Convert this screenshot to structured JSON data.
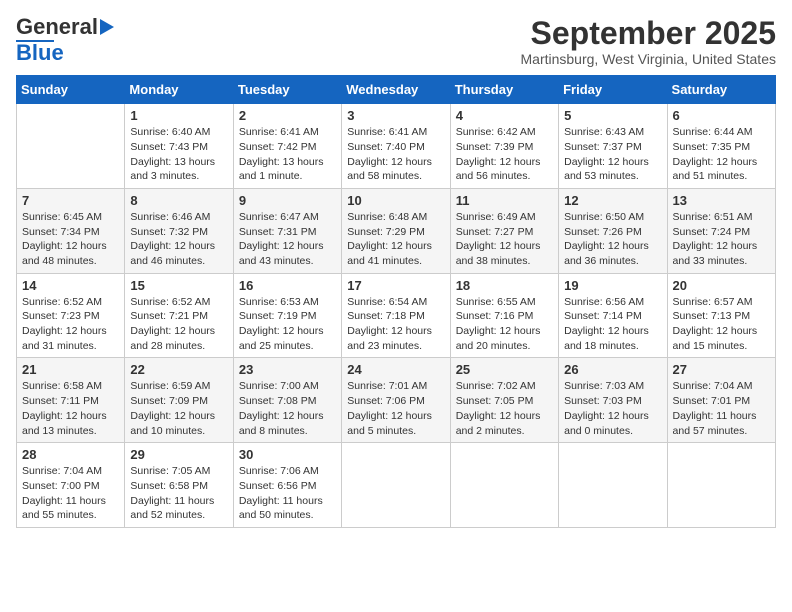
{
  "header": {
    "logo_line1": "General",
    "logo_line2": "Blue",
    "month_title": "September 2025",
    "location": "Martinsburg, West Virginia, United States"
  },
  "columns": [
    "Sunday",
    "Monday",
    "Tuesday",
    "Wednesday",
    "Thursday",
    "Friday",
    "Saturday"
  ],
  "weeks": [
    [
      {
        "day": "",
        "info": ""
      },
      {
        "day": "1",
        "info": "Sunrise: 6:40 AM\nSunset: 7:43 PM\nDaylight: 13 hours\nand 3 minutes."
      },
      {
        "day": "2",
        "info": "Sunrise: 6:41 AM\nSunset: 7:42 PM\nDaylight: 13 hours\nand 1 minute."
      },
      {
        "day": "3",
        "info": "Sunrise: 6:41 AM\nSunset: 7:40 PM\nDaylight: 12 hours\nand 58 minutes."
      },
      {
        "day": "4",
        "info": "Sunrise: 6:42 AM\nSunset: 7:39 PM\nDaylight: 12 hours\nand 56 minutes."
      },
      {
        "day": "5",
        "info": "Sunrise: 6:43 AM\nSunset: 7:37 PM\nDaylight: 12 hours\nand 53 minutes."
      },
      {
        "day": "6",
        "info": "Sunrise: 6:44 AM\nSunset: 7:35 PM\nDaylight: 12 hours\nand 51 minutes."
      }
    ],
    [
      {
        "day": "7",
        "info": "Sunrise: 6:45 AM\nSunset: 7:34 PM\nDaylight: 12 hours\nand 48 minutes."
      },
      {
        "day": "8",
        "info": "Sunrise: 6:46 AM\nSunset: 7:32 PM\nDaylight: 12 hours\nand 46 minutes."
      },
      {
        "day": "9",
        "info": "Sunrise: 6:47 AM\nSunset: 7:31 PM\nDaylight: 12 hours\nand 43 minutes."
      },
      {
        "day": "10",
        "info": "Sunrise: 6:48 AM\nSunset: 7:29 PM\nDaylight: 12 hours\nand 41 minutes."
      },
      {
        "day": "11",
        "info": "Sunrise: 6:49 AM\nSunset: 7:27 PM\nDaylight: 12 hours\nand 38 minutes."
      },
      {
        "day": "12",
        "info": "Sunrise: 6:50 AM\nSunset: 7:26 PM\nDaylight: 12 hours\nand 36 minutes."
      },
      {
        "day": "13",
        "info": "Sunrise: 6:51 AM\nSunset: 7:24 PM\nDaylight: 12 hours\nand 33 minutes."
      }
    ],
    [
      {
        "day": "14",
        "info": "Sunrise: 6:52 AM\nSunset: 7:23 PM\nDaylight: 12 hours\nand 31 minutes."
      },
      {
        "day": "15",
        "info": "Sunrise: 6:52 AM\nSunset: 7:21 PM\nDaylight: 12 hours\nand 28 minutes."
      },
      {
        "day": "16",
        "info": "Sunrise: 6:53 AM\nSunset: 7:19 PM\nDaylight: 12 hours\nand 25 minutes."
      },
      {
        "day": "17",
        "info": "Sunrise: 6:54 AM\nSunset: 7:18 PM\nDaylight: 12 hours\nand 23 minutes."
      },
      {
        "day": "18",
        "info": "Sunrise: 6:55 AM\nSunset: 7:16 PM\nDaylight: 12 hours\nand 20 minutes."
      },
      {
        "day": "19",
        "info": "Sunrise: 6:56 AM\nSunset: 7:14 PM\nDaylight: 12 hours\nand 18 minutes."
      },
      {
        "day": "20",
        "info": "Sunrise: 6:57 AM\nSunset: 7:13 PM\nDaylight: 12 hours\nand 15 minutes."
      }
    ],
    [
      {
        "day": "21",
        "info": "Sunrise: 6:58 AM\nSunset: 7:11 PM\nDaylight: 12 hours\nand 13 minutes."
      },
      {
        "day": "22",
        "info": "Sunrise: 6:59 AM\nSunset: 7:09 PM\nDaylight: 12 hours\nand 10 minutes."
      },
      {
        "day": "23",
        "info": "Sunrise: 7:00 AM\nSunset: 7:08 PM\nDaylight: 12 hours\nand 8 minutes."
      },
      {
        "day": "24",
        "info": "Sunrise: 7:01 AM\nSunset: 7:06 PM\nDaylight: 12 hours\nand 5 minutes."
      },
      {
        "day": "25",
        "info": "Sunrise: 7:02 AM\nSunset: 7:05 PM\nDaylight: 12 hours\nand 2 minutes."
      },
      {
        "day": "26",
        "info": "Sunrise: 7:03 AM\nSunset: 7:03 PM\nDaylight: 12 hours\nand 0 minutes."
      },
      {
        "day": "27",
        "info": "Sunrise: 7:04 AM\nSunset: 7:01 PM\nDaylight: 11 hours\nand 57 minutes."
      }
    ],
    [
      {
        "day": "28",
        "info": "Sunrise: 7:04 AM\nSunset: 7:00 PM\nDaylight: 11 hours\nand 55 minutes."
      },
      {
        "day": "29",
        "info": "Sunrise: 7:05 AM\nSunset: 6:58 PM\nDaylight: 11 hours\nand 52 minutes."
      },
      {
        "day": "30",
        "info": "Sunrise: 7:06 AM\nSunset: 6:56 PM\nDaylight: 11 hours\nand 50 minutes."
      },
      {
        "day": "",
        "info": ""
      },
      {
        "day": "",
        "info": ""
      },
      {
        "day": "",
        "info": ""
      },
      {
        "day": "",
        "info": ""
      }
    ]
  ]
}
